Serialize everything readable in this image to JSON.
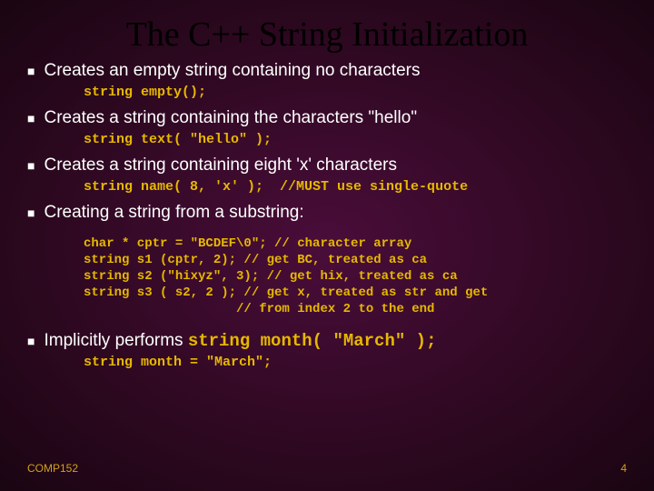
{
  "title": "The C++ String Initialization",
  "items": [
    {
      "text": "Creates an empty string containing no characters",
      "code": "string empty();"
    },
    {
      "text": "Creates a string containing the characters \"hello\"",
      "code": "string text( \"hello\" );"
    },
    {
      "text": "Creates a string containing eight 'x' characters",
      "code": "string name( 8, 'x' );  //MUST use single-quote"
    },
    {
      "text": "Creating a string from a substring:",
      "codeblock": "char * cptr = \"BCDEF\\0\"; // character array\nstring s1 (cptr, 2); // get BC, treated as ca\nstring s2 (\"hixyz\", 3); // get hix, treated as ca\nstring s3 ( s2, 2 ); // get x, treated as str and get\n                    // from index 2 to the end"
    }
  ],
  "implicit": {
    "prefix": "Implicitly performs ",
    "inline": "string month( \"March\" );",
    "code": "string month = \"March\";"
  },
  "footer": {
    "left": "COMP152",
    "right": "4"
  }
}
